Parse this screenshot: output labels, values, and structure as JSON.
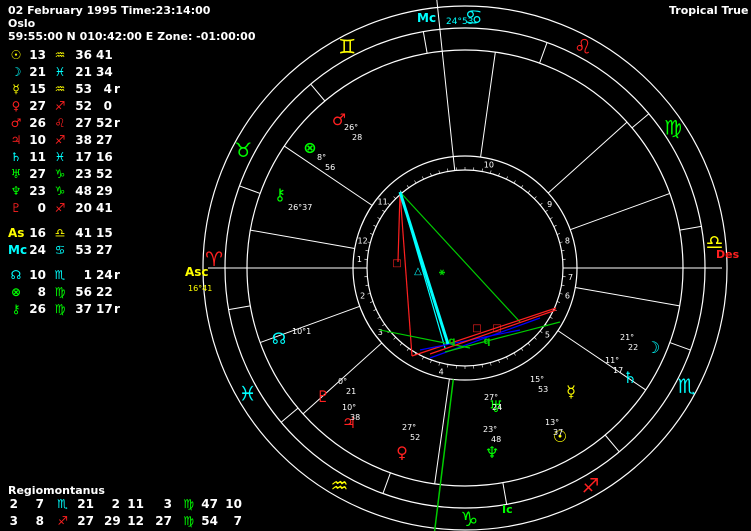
{
  "header": {
    "date_time": "02 February 1995 Time:23:14:00",
    "place": "Oslo",
    "coords": "59:55:00 N 010:42:00 E  Zone: -01:00:00",
    "system": "Tropical True"
  },
  "planets": [
    {
      "glyph": "☉",
      "gcol": "#ffff00",
      "deg": "13",
      "sign": "♒",
      "scol": "#ffff00",
      "min": "36",
      "sec": "41",
      "r": ""
    },
    {
      "glyph": "☽",
      "gcol": "#00ffff",
      "deg": "21",
      "sign": "♓",
      "scol": "#00ffff",
      "min": "21",
      "sec": "34",
      "r": ""
    },
    {
      "glyph": "☿",
      "gcol": "#ffff00",
      "deg": "15",
      "sign": "♒",
      "scol": "#ffff00",
      "min": "53",
      "sec": "4",
      "r": "r"
    },
    {
      "glyph": "♀",
      "gcol": "#ff2020",
      "deg": "27",
      "sign": "♐",
      "scol": "#ff2020",
      "min": "52",
      "sec": "0",
      "r": ""
    },
    {
      "glyph": "♂",
      "gcol": "#ff2020",
      "deg": "26",
      "sign": "♌",
      "scol": "#ff2020",
      "min": "27",
      "sec": "52",
      "r": "r"
    },
    {
      "glyph": "♃",
      "gcol": "#ff2020",
      "deg": "10",
      "sign": "♐",
      "scol": "#ff2020",
      "min": "38",
      "sec": "27",
      "r": ""
    },
    {
      "glyph": "♄",
      "gcol": "#00ffff",
      "deg": "11",
      "sign": "♓",
      "scol": "#00ffff",
      "min": "17",
      "sec": "16",
      "r": ""
    },
    {
      "glyph": "♅",
      "gcol": "#00ff00",
      "deg": "27",
      "sign": "♑",
      "scol": "#00ff00",
      "min": "23",
      "sec": "52",
      "r": ""
    },
    {
      "glyph": "♆",
      "gcol": "#00ff00",
      "deg": "23",
      "sign": "♑",
      "scol": "#00ff00",
      "min": "48",
      "sec": "29",
      "r": ""
    },
    {
      "glyph": "♇",
      "gcol": "#ff2020",
      "deg": "0",
      "sign": "♐",
      "scol": "#ff2020",
      "min": "20",
      "sec": "41",
      "r": ""
    },
    {
      "glyph": "As",
      "gcol": "#ffff00",
      "deg": "16",
      "sign": "♎",
      "scol": "#ffff00",
      "min": "41",
      "sec": "15",
      "r": "",
      "gap": true
    },
    {
      "glyph": "Mc",
      "gcol": "#00ffff",
      "deg": "24",
      "sign": "♋",
      "scol": "#00ffff",
      "min": "53",
      "sec": "27",
      "r": ""
    },
    {
      "glyph": "☊",
      "gcol": "#00ffff",
      "deg": "10",
      "sign": "♏",
      "scol": "#00ffff",
      "min": "1",
      "sec": "24",
      "r": "r",
      "gap": true
    },
    {
      "glyph": "⊗",
      "gcol": "#00ff00",
      "deg": "8",
      "sign": "♍",
      "scol": "#00ff00",
      "min": "56",
      "sec": "22",
      "r": ""
    },
    {
      "glyph": "⚷",
      "gcol": "#00ff00",
      "deg": "26",
      "sign": "♍",
      "scol": "#00ff00",
      "min": "37",
      "sec": "17",
      "r": "r"
    }
  ],
  "regio": {
    "title": "Regiomontanus",
    "rows": [
      {
        "a": "2",
        "b": "7",
        "s1": "♏",
        "c": "21",
        "d": "2",
        "e": "11",
        "f": "3",
        "s2": "♍",
        "g": "47",
        "h": "10",
        "s1c": "#00ffff",
        "s2c": "#00ff00"
      },
      {
        "a": "3",
        "b": "8",
        "s1": "♐",
        "c": "27",
        "d": "29",
        "e": "12",
        "f": "27",
        "s2": "♍",
        "g": "54",
        "h": "7",
        "s1c": "#ff2020",
        "s2c": "#00ff00"
      }
    ]
  },
  "wheel": {
    "mc_label": "Mc",
    "mc_deg": "24°53",
    "ic_label": "Ic",
    "asc_label": "Asc",
    "asc_deg": "16°41",
    "des_label": "Des",
    "houses": [
      "1",
      "2",
      "3",
      "4",
      "5",
      "6",
      "7",
      "8",
      "9",
      "10",
      "11",
      "12"
    ],
    "sign_ring": [
      {
        "glyph": "♋",
        "color": "#00ffff"
      },
      {
        "glyph": "♌",
        "color": "#ff2020"
      },
      {
        "glyph": "♍",
        "color": "#00ff00"
      },
      {
        "glyph": "♎",
        "color": "#ffff00"
      },
      {
        "glyph": "♏",
        "color": "#00ffff"
      },
      {
        "glyph": "♐",
        "color": "#ff2020"
      },
      {
        "glyph": "♑",
        "color": "#00ff00"
      },
      {
        "glyph": "♒",
        "color": "#ffff00"
      },
      {
        "glyph": "♓",
        "color": "#00ffff"
      },
      {
        "glyph": "♈",
        "color": "#ff2020"
      },
      {
        "glyph": "♉",
        "color": "#00ff00"
      },
      {
        "glyph": "♊",
        "color": "#ffff00"
      }
    ],
    "chart_planets": [
      {
        "glyph": "♂",
        "color": "#ff2020",
        "deg": "26°",
        "min": "28"
      },
      {
        "glyph": "⊗",
        "color": "#00ff00",
        "deg": "8°",
        "min": "56"
      },
      {
        "glyph": "⚷",
        "color": "#00ff00",
        "deg": "26°37",
        "min": ""
      },
      {
        "glyph": "☊",
        "color": "#00ffff",
        "deg": "10°1",
        "min": ""
      },
      {
        "glyph": "♇",
        "color": "#ff2020",
        "deg": "0°",
        "min": "21"
      },
      {
        "glyph": "♃",
        "color": "#ff2020",
        "deg": "10°",
        "min": "38"
      },
      {
        "glyph": "♀",
        "color": "#ff2020",
        "deg": "27°",
        "min": "52"
      },
      {
        "glyph": "♆",
        "color": "#00ff00",
        "deg": "23°",
        "min": "48"
      },
      {
        "glyph": "♅",
        "color": "#00ff00",
        "deg": "27°",
        "min": "24"
      },
      {
        "glyph": "☉",
        "color": "#ffff00",
        "deg": "13°",
        "min": "37"
      },
      {
        "glyph": "☿",
        "color": "#ffff00",
        "deg": "15°",
        "min": "53"
      },
      {
        "glyph": "♄",
        "color": "#00ffff",
        "deg": "11°",
        "min": "17"
      },
      {
        "glyph": "☽",
        "color": "#00ffff",
        "deg": "21°",
        "min": "22"
      }
    ],
    "inner_symbols": [
      "□",
      "△",
      "⚹",
      "□",
      "□",
      "q",
      "q"
    ]
  }
}
